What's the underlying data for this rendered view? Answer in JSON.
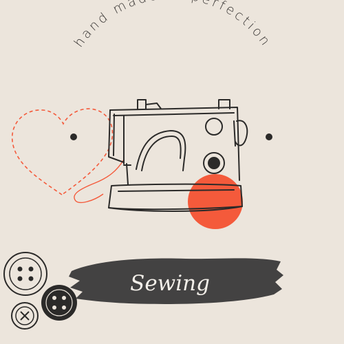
{
  "tagline": "hand made to perfection",
  "brand_name": "Sewing",
  "colors": {
    "background": "#ece5dc",
    "ink": "#2b2a29",
    "accent": "#f45a3b",
    "brush": "#434242",
    "brand_text": "#f3efe9"
  },
  "icons": [
    "heart-outline-icon",
    "sewing-machine-icon",
    "button-icon"
  ]
}
